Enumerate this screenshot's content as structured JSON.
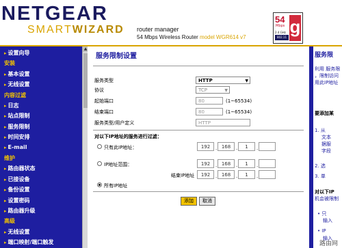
{
  "header": {
    "brand": "NETGEAR",
    "product_a": "SMART",
    "product_b": "WIZARD",
    "subtitle": "router manager",
    "desc": "54 Mbps Wireless Router",
    "model": "model WGR614 v7",
    "badge": {
      "speed": "54",
      "unit": "Mbps",
      "band": "2.4 GHz",
      "std": "802.11",
      "letter": "g"
    }
  },
  "sidebar": {
    "items": [
      {
        "type": "item",
        "label": "设置向导"
      },
      {
        "type": "group",
        "label": "安装"
      },
      {
        "type": "item",
        "label": "基本设置"
      },
      {
        "type": "item",
        "label": "无线设置"
      },
      {
        "type": "group",
        "label": "内容过滤"
      },
      {
        "type": "item",
        "label": "日志"
      },
      {
        "type": "item",
        "label": "站点限制"
      },
      {
        "type": "item",
        "label": "服务限制"
      },
      {
        "type": "item",
        "label": "时间安排"
      },
      {
        "type": "item",
        "label": "E-mail"
      },
      {
        "type": "group",
        "label": "维护"
      },
      {
        "type": "item",
        "label": "路由器状态"
      },
      {
        "type": "item",
        "label": "已接设备"
      },
      {
        "type": "item",
        "label": "备份设置"
      },
      {
        "type": "item",
        "label": "设置密码"
      },
      {
        "type": "item",
        "label": "路由器升级"
      },
      {
        "type": "group",
        "label": "高级"
      },
      {
        "type": "item",
        "label": "无线设置"
      },
      {
        "type": "item",
        "label": "端口映射/端口触发"
      }
    ]
  },
  "form": {
    "title": "服务限制设置",
    "service_type_label": "服务类型",
    "service_type_value": "HTTP",
    "protocol_label": "协议",
    "protocol_value": "TCP",
    "start_port_label": "起始端口",
    "start_port_value": "80",
    "start_port_range": "(1~65534)",
    "end_port_label": "结束端口",
    "end_port_value": "80",
    "end_port_range": "(1~65534)",
    "user_def_label": "服务类型/用户定义",
    "user_def_value": "HTTP",
    "filter_heading": "对以下IP地址的服务进行过滤：",
    "only_ip_label": "只有此IP地址：",
    "ip_range_label": "IP地址范围：",
    "end_ip_label": "结束IP地址",
    "all_ip_label": "所有IP地址",
    "only_ip": [
      "192",
      "168",
      "1",
      ""
    ],
    "range_start": [
      "192",
      "168",
      "1",
      ""
    ],
    "range_end": [
      "192",
      "168",
      "1",
      ""
    ],
    "add_button": "添加",
    "cancel_button": "取消"
  },
  "help": {
    "title": "服务限",
    "lines": [
      "利用 服务限",
      "，限制访问",
      "用此IP地址",
      "要添加某",
      "1. 从",
      "文本",
      "据服",
      "字段",
      "2. 选",
      "3. 单"
    ],
    "filter_heading": "对以下IP",
    "filter_sub": "机会被限制",
    "bullet1": "• 只",
    "bullet1_sub": "输入",
    "bullet2": "• IP",
    "bullet2_sub": "输入"
  },
  "watermark": "路由网"
}
